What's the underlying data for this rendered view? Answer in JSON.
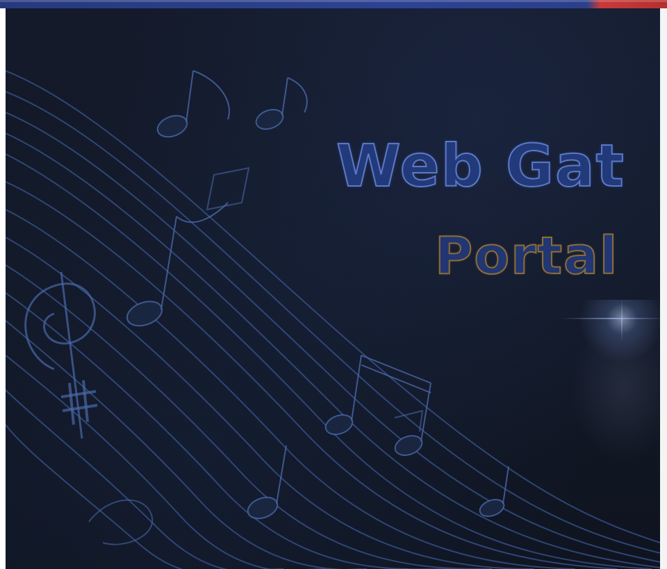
{
  "banner": {
    "title_line1": "Web Gat",
    "title_line2": "Portal",
    "colors": {
      "background": "#121826",
      "title_fill": "#223a7a",
      "title_outline": "#5c79c8",
      "subtitle_outline": "#8a6d3b",
      "top_strip": "#2d4393",
      "top_strip_accent": "#c93a3a"
    },
    "decorations": [
      "music-staff-icon",
      "music-note-icon",
      "treble-clef-icon",
      "sharp-sign-icon",
      "light-flare"
    ]
  }
}
